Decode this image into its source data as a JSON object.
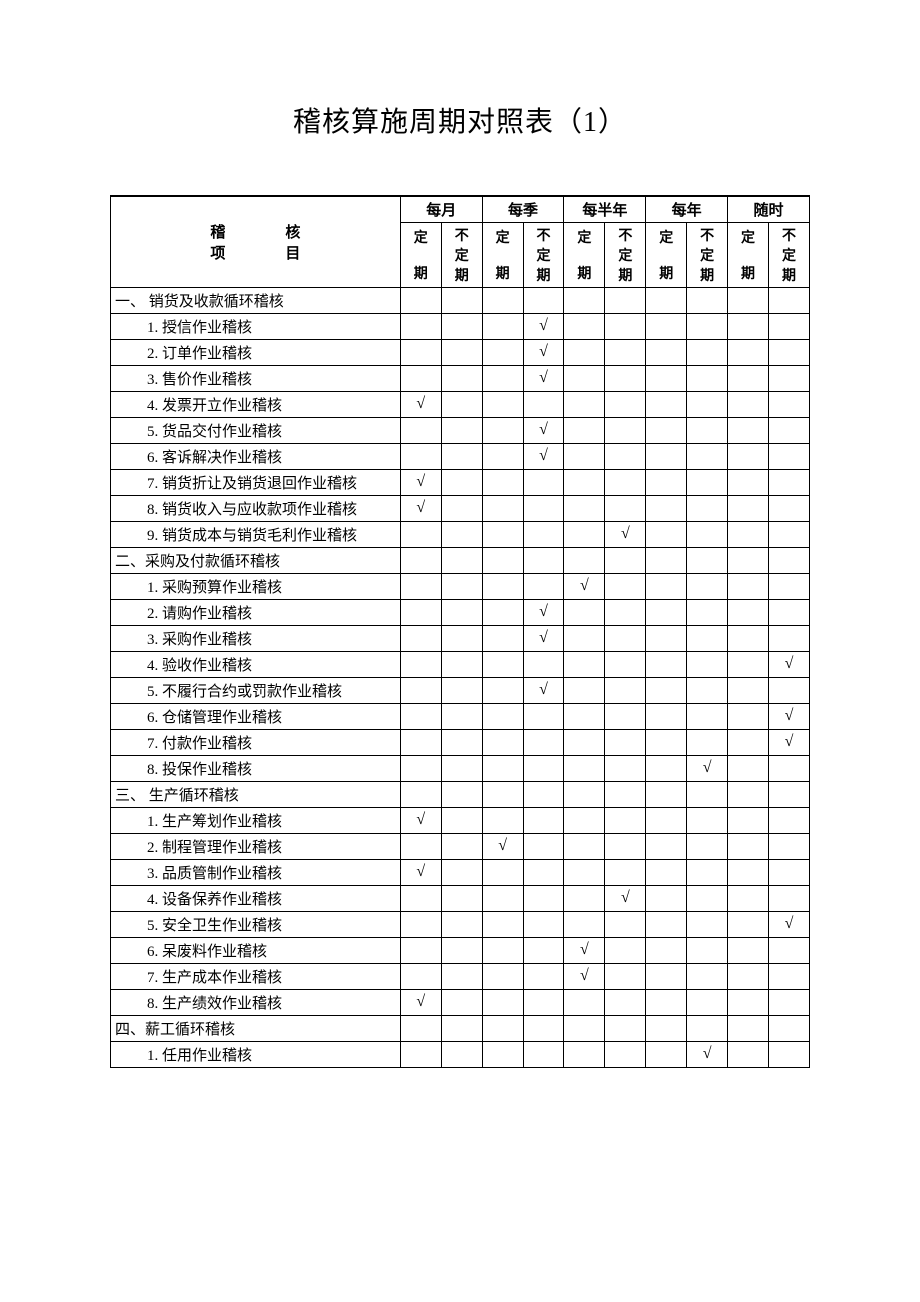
{
  "title": "稽核算施周期对照表（1）",
  "header": {
    "item_label_line1": "稽　　　　核",
    "item_label_line2": "项　　　　目",
    "periods": [
      "每月",
      "每季",
      "每半年",
      "每年",
      "随时"
    ],
    "sub_fixed": "定期",
    "sub_unfixed": "不定期"
  },
  "tick_mark": "√",
  "rows": [
    {
      "label": "一、 销货及收款循环稽核",
      "cls": "",
      "checks": [
        0,
        0,
        0,
        0,
        0,
        0,
        0,
        0,
        0,
        0
      ]
    },
    {
      "label": "1. 授信作业稽核",
      "cls": "sub-item",
      "checks": [
        0,
        0,
        0,
        1,
        0,
        0,
        0,
        0,
        0,
        0
      ]
    },
    {
      "label": "2. 订单作业稽核",
      "cls": "sub-item",
      "checks": [
        0,
        0,
        0,
        1,
        0,
        0,
        0,
        0,
        0,
        0
      ]
    },
    {
      "label": "3. 售价作业稽核",
      "cls": "sub-item",
      "checks": [
        0,
        0,
        0,
        1,
        0,
        0,
        0,
        0,
        0,
        0
      ]
    },
    {
      "label": "4. 发票开立作业稽核",
      "cls": "sub-item",
      "checks": [
        1,
        0,
        0,
        0,
        0,
        0,
        0,
        0,
        0,
        0
      ]
    },
    {
      "label": "5. 货品交付作业稽核",
      "cls": "sub-item",
      "checks": [
        0,
        0,
        0,
        1,
        0,
        0,
        0,
        0,
        0,
        0
      ]
    },
    {
      "label": "6. 客诉解决作业稽核",
      "cls": "sub-item",
      "checks": [
        0,
        0,
        0,
        1,
        0,
        0,
        0,
        0,
        0,
        0
      ]
    },
    {
      "label": "7. 销货折让及销货退回作业稽核",
      "cls": "sub-item",
      "checks": [
        1,
        0,
        0,
        0,
        0,
        0,
        0,
        0,
        0,
        0
      ]
    },
    {
      "label": "8. 销货收入与应收款项作业稽核",
      "cls": "sub-item",
      "checks": [
        1,
        0,
        0,
        0,
        0,
        0,
        0,
        0,
        0,
        0
      ]
    },
    {
      "label": "9. 销货成本与销货毛利作业稽核",
      "cls": "sub-item",
      "checks": [
        0,
        0,
        0,
        0,
        0,
        1,
        0,
        0,
        0,
        0
      ]
    },
    {
      "label": "二、采购及付款循环稽核",
      "cls": "",
      "checks": [
        0,
        0,
        0,
        0,
        0,
        0,
        0,
        0,
        0,
        0
      ]
    },
    {
      "label": "1. 采购预算作业稽核",
      "cls": "sub-item",
      "checks": [
        0,
        0,
        0,
        0,
        1,
        0,
        0,
        0,
        0,
        0
      ]
    },
    {
      "label": "2. 请购作业稽核",
      "cls": "sub-item",
      "checks": [
        0,
        0,
        0,
        1,
        0,
        0,
        0,
        0,
        0,
        0
      ]
    },
    {
      "label": "3. 采购作业稽核",
      "cls": "sub-item",
      "checks": [
        0,
        0,
        0,
        1,
        0,
        0,
        0,
        0,
        0,
        0
      ]
    },
    {
      "label": "4. 验收作业稽核",
      "cls": "sub-item",
      "checks": [
        0,
        0,
        0,
        0,
        0,
        0,
        0,
        0,
        0,
        1
      ]
    },
    {
      "label": "5. 不履行合约或罚款作业稽核",
      "cls": "sub-item",
      "checks": [
        0,
        0,
        0,
        1,
        0,
        0,
        0,
        0,
        0,
        0
      ]
    },
    {
      "label": "6. 仓储管理作业稽核",
      "cls": "sub-item",
      "checks": [
        0,
        0,
        0,
        0,
        0,
        0,
        0,
        0,
        0,
        1
      ]
    },
    {
      "label": "7. 付款作业稽核",
      "cls": "sub-item",
      "checks": [
        0,
        0,
        0,
        0,
        0,
        0,
        0,
        0,
        0,
        1
      ]
    },
    {
      "label": "8. 投保作业稽核",
      "cls": "sub-item",
      "checks": [
        0,
        0,
        0,
        0,
        0,
        0,
        0,
        1,
        0,
        0
      ]
    },
    {
      "label": "三、 生产循环稽核",
      "cls": "",
      "checks": [
        0,
        0,
        0,
        0,
        0,
        0,
        0,
        0,
        0,
        0
      ]
    },
    {
      "label": "1. 生产筹划作业稽核",
      "cls": "sub-item",
      "checks": [
        1,
        0,
        0,
        0,
        0,
        0,
        0,
        0,
        0,
        0
      ]
    },
    {
      "label": "2. 制程管理作业稽核",
      "cls": "sub-item",
      "checks": [
        0,
        0,
        1,
        0,
        0,
        0,
        0,
        0,
        0,
        0
      ]
    },
    {
      "label": "3. 品质管制作业稽核",
      "cls": "sub-item",
      "checks": [
        1,
        0,
        0,
        0,
        0,
        0,
        0,
        0,
        0,
        0
      ]
    },
    {
      "label": "4. 设备保养作业稽核",
      "cls": "sub-item",
      "checks": [
        0,
        0,
        0,
        0,
        0,
        1,
        0,
        0,
        0,
        0
      ]
    },
    {
      "label": "5. 安全卫生作业稽核",
      "cls": "sub-item",
      "checks": [
        0,
        0,
        0,
        0,
        0,
        0,
        0,
        0,
        0,
        1
      ]
    },
    {
      "label": "6. 呆废料作业稽核",
      "cls": "sub-item",
      "checks": [
        0,
        0,
        0,
        0,
        1,
        0,
        0,
        0,
        0,
        0
      ]
    },
    {
      "label": "7. 生产成本作业稽核",
      "cls": "sub-item",
      "checks": [
        0,
        0,
        0,
        0,
        1,
        0,
        0,
        0,
        0,
        0
      ]
    },
    {
      "label": "8. 生产绩效作业稽核",
      "cls": "sub-item",
      "checks": [
        1,
        0,
        0,
        0,
        0,
        0,
        0,
        0,
        0,
        0
      ]
    },
    {
      "label": "四、薪工循环稽核",
      "cls": "",
      "checks": [
        0,
        0,
        0,
        0,
        0,
        0,
        0,
        0,
        0,
        0
      ]
    },
    {
      "label": "1. 任用作业稽核",
      "cls": "sub-item",
      "checks": [
        0,
        0,
        0,
        0,
        0,
        0,
        0,
        1,
        0,
        0
      ]
    }
  ]
}
